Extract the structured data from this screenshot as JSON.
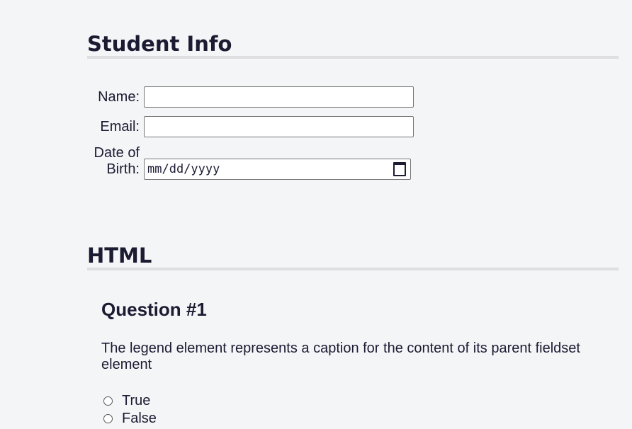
{
  "student_info": {
    "heading": "Student Info",
    "name_label": "Name:",
    "name_value": "",
    "email_label": "Email:",
    "email_value": "",
    "dob_label_line1": "Date of",
    "dob_label_line2": "Birth:",
    "dob_placeholder": "mm/dd/yyyy"
  },
  "html_section": {
    "heading": "HTML",
    "question": {
      "title": "Question #1",
      "text": "The legend element represents a caption for the content of its parent fieldset element",
      "options": [
        {
          "label": "True",
          "checked": false
        },
        {
          "label": "False",
          "checked": false
        }
      ]
    }
  },
  "icons": {
    "date_picker": "calendar-icon"
  }
}
